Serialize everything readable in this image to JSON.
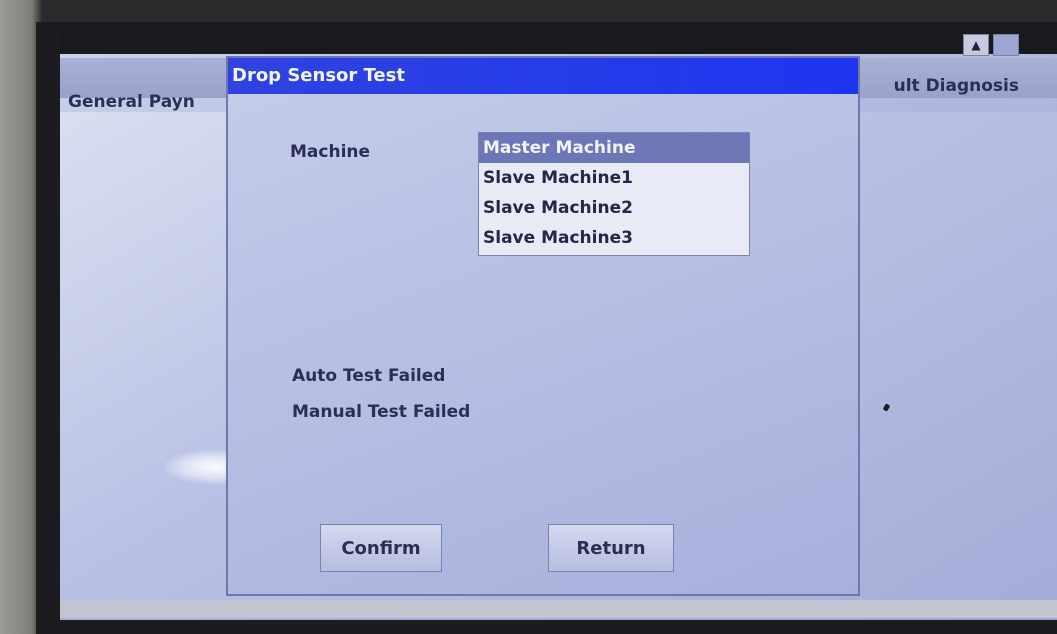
{
  "background_tabs": {
    "left_partial": "General Payn",
    "right_partial": "ult Diagnosis"
  },
  "window_controls": {
    "up_glyph": "▲",
    "restore_glyph": ""
  },
  "dialog": {
    "title": "Drop Sensor Test",
    "machine_label": "Machine",
    "machine_options": [
      {
        "label": "Master Machine",
        "selected": true
      },
      {
        "label": "Slave Machine1",
        "selected": false
      },
      {
        "label": "Slave Machine2",
        "selected": false
      },
      {
        "label": "Slave Machine3",
        "selected": false
      }
    ],
    "auto_test_status": "Auto Test Failed",
    "manual_test_status": "Manual Test Failed",
    "confirm_label": "Confirm",
    "return_label": "Return"
  },
  "colors": {
    "title_bar": "#1d35f0",
    "selected_item": "#6d76b7",
    "panel": "#b5bee3"
  }
}
